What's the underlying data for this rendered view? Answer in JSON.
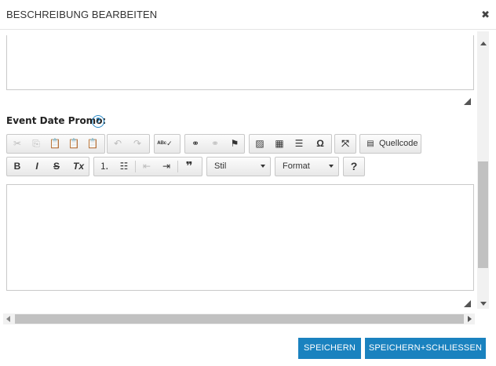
{
  "dialog": {
    "title": "BESCHREIBUNG BEARBEITEN",
    "close_glyph": "✖"
  },
  "field": {
    "label": "Event Date Promo:",
    "help_glyph": "?"
  },
  "toolbar": {
    "row1": {
      "group1": [
        "cut-icon",
        "copy-icon",
        "paste-icon",
        "paste-text-icon",
        "paste-word-icon"
      ],
      "group2": [
        "undo-icon",
        "redo-icon"
      ],
      "group3": [
        "spellcheck-icon"
      ],
      "group4": [
        "link-icon",
        "unlink-icon",
        "anchor-icon"
      ],
      "group5": [
        "image-icon",
        "table-icon",
        "horizontal-line-icon",
        "special-char-icon"
      ],
      "group6": [
        "maximize-icon"
      ],
      "source_label": "Quellcode"
    },
    "row2": {
      "bold": "B",
      "italic": "I",
      "strike": "S",
      "remove_format": "Tx",
      "style_combo": "Stil",
      "format_combo": "Format",
      "about": "?"
    }
  },
  "footer": {
    "save_label": "SPEICHERN",
    "save_close_label": "SPEICHERN+SCHLIESSEN",
    "button_color": "#1a82bf"
  }
}
